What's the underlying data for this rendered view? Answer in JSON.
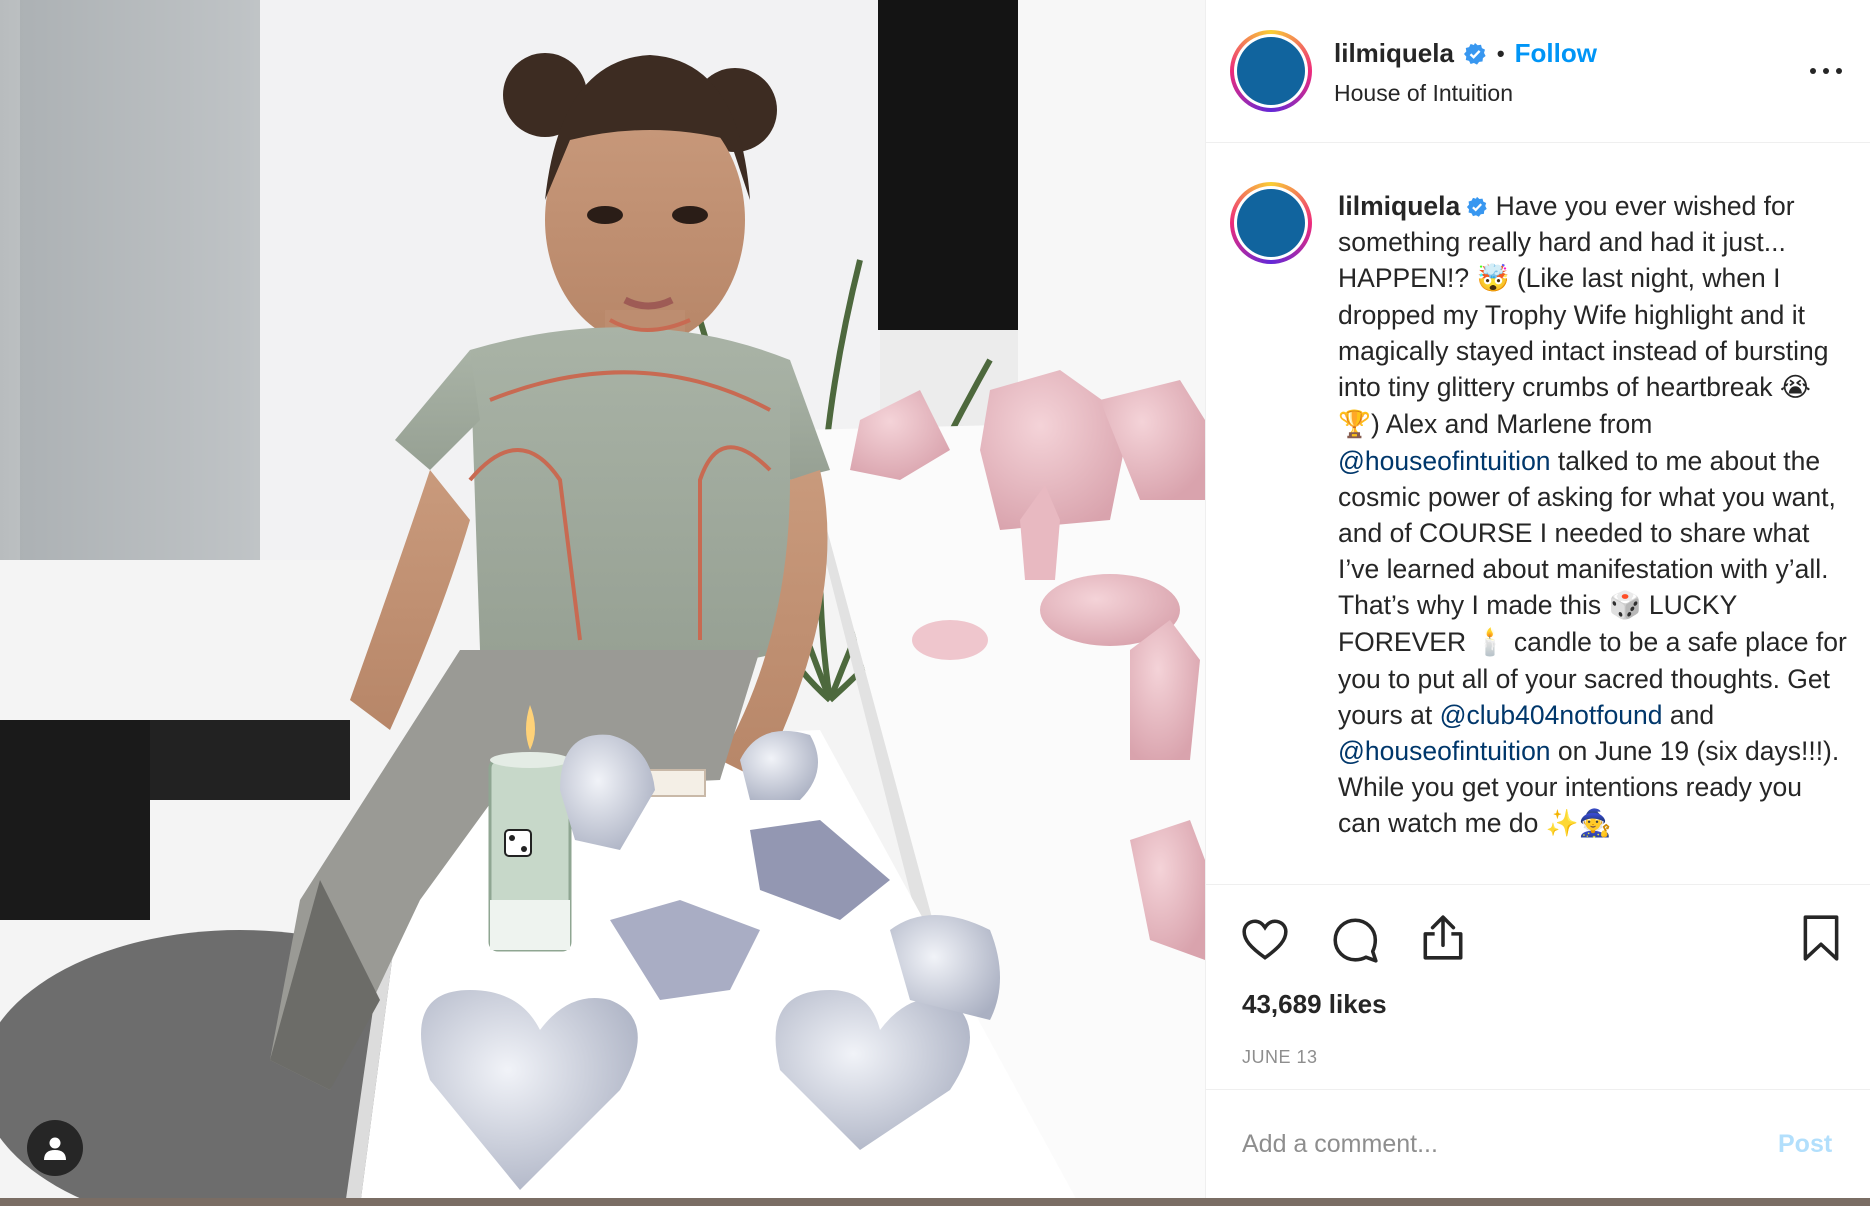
{
  "post": {
    "username": "lilmiquela",
    "verified": true,
    "separator": "•",
    "follow_label": "Follow",
    "location": "House of Intuition",
    "likes": "43,689 likes",
    "date": "JUNE 13",
    "comment_placeholder": "Add a comment...",
    "post_label": "Post"
  },
  "caption": {
    "username": "lilmiquela",
    "part1": " Have you ever wished for something really hard and had it just... HAPPEN!? ",
    "emoji1": "🤯",
    "part2": " (Like last night, when I dropped my Trophy Wife highlight and it magically stayed intact instead of bursting into tiny glittery crumbs of heartbreak ",
    "emoji2": "😭🏆",
    "part3": ") Alex and Marlene from ",
    "mention1": "@houseofintuition",
    "part4": " talked to me about the cosmic power of asking for what you want, and of COURSE I needed to share what I’ve learned about manifestation with y’all. That’s why I made this ",
    "emoji3": "🎲",
    "part5": " LUCKY FOREVER ",
    "emoji4": "🕯️",
    "part6": " candle to be a safe place for you to put all of your sacred thoughts. Get yours at ",
    "mention2": "@club404notfound",
    "part7": " and ",
    "mention3": "@houseofintuition",
    "part8": " on June 19 (six days!!!). While you get your intentions ready you can watch me do ",
    "emoji5": "✨🧙"
  },
  "icons": {
    "tag": "user-tag-icon",
    "more": "more-options-icon",
    "like": "heart-icon",
    "comment": "comment-icon",
    "share": "share-icon",
    "save": "bookmark-icon",
    "verified": "verified-badge-icon"
  },
  "colors": {
    "link": "#0095f6",
    "mention": "#00376b",
    "avatar": "#11649e",
    "post_disabled": "#b2dffc",
    "muted": "#8e8e8e"
  }
}
